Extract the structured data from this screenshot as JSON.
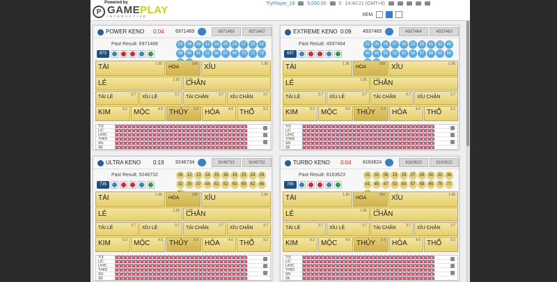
{
  "brand": {
    "powered_by": "Powered by",
    "name_a": "GAME",
    "name_b": "PLAY",
    "sub": "INTERACTIVE",
    "logo_mark": "P"
  },
  "user": {
    "name": "TryPlayer_19",
    "balance": "5,000.00",
    "count": "0",
    "time": "14:40:21 (GMT+8)"
  },
  "view_label": "XEM",
  "games": [
    {
      "name": "POWER KENO",
      "timer": "0:04",
      "draw": "6971469",
      "tab1": "6971468",
      "tab2": "6971467",
      "past": "Past Result: 6971468",
      "round": "873",
      "balls": [
        "03",
        "06",
        "09",
        "12",
        "16",
        "20",
        "24",
        "27",
        "29",
        "31",
        "36",
        "40",
        "41",
        "51",
        "56",
        "67",
        "68",
        "70",
        "71",
        "75",
        "79",
        "80"
      ],
      "bets": {
        "tai": "TÀI",
        "tai_o": "1.95",
        "hoa": "HÒA",
        "hoa_o": "108",
        "xiu": "XỈU",
        "xiu_o": "1.95",
        "le": "LẺ",
        "le_o": "1.95",
        "chan": "CHẴN",
        "chan_o": "1.95",
        "taile": "TÀI LẺ",
        "taile_o": "3.7",
        "xiule": "XỈU LẺ",
        "xiule_o": "3.7",
        "taichan": "TÀI CHẴN",
        "taichan_o": "3.7",
        "xiuchan": "XỈU CHẴN",
        "xiuchan_o": "3.7",
        "kim": "KIM",
        "kim_o": "9.2",
        "moc": "MỘC",
        "moc_o": "4.6",
        "thuy": "THỦY",
        "thuy_o": "2.4",
        "hoa2": "HỎA",
        "hoa2_o": "4.6",
        "tho": "THỔ",
        "tho_o": "9.2"
      },
      "stats": [
        "T/X",
        "L/C",
        "L/H/C",
        "T/H/D",
        "SN",
        "SE"
      ]
    },
    {
      "name": "EXTREME KENO",
      "timer": "0:09",
      "draw": "4937465",
      "tab1": "4937464",
      "tab2": "4937463",
      "past": "Past Result: 4937464",
      "round": "697",
      "balls": [
        "01",
        "05",
        "06",
        "07",
        "08",
        "13",
        "25",
        "31",
        "33",
        "40",
        "45",
        "46",
        "50",
        "53",
        "55",
        "56",
        "57",
        "58",
        "63",
        "65",
        "72",
        "80"
      ],
      "bets": {
        "tai": "TÀI",
        "tai_o": "1.95",
        "hoa": "HÒA",
        "hoa_o": "108",
        "xiu": "XỈU",
        "xiu_o": "1.95",
        "le": "LẺ",
        "le_o": "1.95",
        "chan": "CHẴN",
        "chan_o": "1.95",
        "taile": "TÀI LẺ",
        "taile_o": "3.7",
        "xiule": "XỈU LẺ",
        "xiule_o": "3.7",
        "taichan": "TÀI CHẴN",
        "taichan_o": "3.7",
        "xiuchan": "XỈU CHẴN",
        "xiuchan_o": "3.7",
        "kim": "KIM",
        "kim_o": "9.2",
        "moc": "MỘC",
        "moc_o": "4.6",
        "thuy": "THỦY",
        "thuy_o": "2.4",
        "hoa2": "HỎA",
        "hoa2_o": "4.6",
        "tho": "THỔ",
        "tho_o": "9.2"
      },
      "stats": [
        "T/X",
        "L/C",
        "L/H/C",
        "T/H/D",
        "SN",
        "SE"
      ]
    },
    {
      "name": "ULTRA KENO",
      "timer": "0:19",
      "draw": "9246734",
      "tab1": "9246733",
      "tab2": "9246732",
      "past": "Past Result: 9246732",
      "round": "735",
      "balls": [
        "06",
        "12",
        "13",
        "14",
        "15",
        "16",
        "19",
        "23",
        "24",
        "29",
        "32",
        "35",
        "37",
        "44",
        "51",
        "52",
        "53",
        "59",
        "62",
        "66",
        "74"
      ],
      "bets": {
        "tai": "TÀI",
        "tai_o": "1.95",
        "hoa": "HÒA",
        "hoa_o": "108",
        "xiu": "XỈU",
        "xiu_o": "1.95",
        "le": "LẺ",
        "le_o": "1.95",
        "chan": "CHẴN",
        "chan_o": "1.95",
        "taile": "TÀI LẺ",
        "taile_o": "3.7",
        "xiule": "XỈU LẺ",
        "xiule_o": "3.7",
        "taichan": "TÀI CHẴN",
        "taichan_o": "3.7",
        "xiuchan": "XỈU CHẴN",
        "xiuchan_o": "3.7",
        "kim": "KIM",
        "kim_o": "9.2",
        "moc": "MỘC",
        "moc_o": "4.6",
        "thuy": "THỦY",
        "thuy_o": "2.4",
        "hoa2": "HỎA",
        "hoa2_o": "4.6",
        "tho": "THỔ",
        "tho_o": "9.2"
      },
      "stats": [
        "T/X",
        "L/C",
        "L/H/C",
        "T/H/D",
        "SN",
        "SE"
      ]
    },
    {
      "name": "TURBO KENO",
      "timer": "0:04",
      "draw": "8163624",
      "tab1": "8163623",
      "tab2": "8163622",
      "past": "Past Result: 8163623",
      "round": "785",
      "balls": [
        "01",
        "02",
        "06",
        "13",
        "19",
        "27",
        "28",
        "30",
        "32",
        "36",
        "41",
        "45",
        "47",
        "53",
        "54",
        "57",
        "58",
        "65",
        "75",
        "77",
        "80"
      ],
      "bets": {
        "tai": "TÀI",
        "tai_o": "1.95",
        "hoa": "HÒA",
        "hoa_o": "108",
        "xiu": "XỈU",
        "xiu_o": "1.95",
        "le": "LẺ",
        "le_o": "1.95",
        "chan": "CHẴN",
        "chan_o": "1.95",
        "taile": "TÀI LẺ",
        "taile_o": "3.7",
        "xiule": "XỈU LẺ",
        "xiule_o": "3.7",
        "taichan": "TÀI CHẴN",
        "taichan_o": "3.7",
        "xiuchan": "XỈU CHẴN",
        "xiuchan_o": "3.7",
        "kim": "KIM",
        "kim_o": "9.2",
        "moc": "MỘC",
        "moc_o": "4.6",
        "thuy": "THỦY",
        "thuy_o": "2.4",
        "hoa2": "HỎA",
        "hoa2_o": "4.6",
        "tho": "THỔ",
        "tho_o": "9.2"
      },
      "stats": [
        "T/X",
        "L/C",
        "L/H/C",
        "T/H/D",
        "SN",
        "SE"
      ]
    }
  ]
}
